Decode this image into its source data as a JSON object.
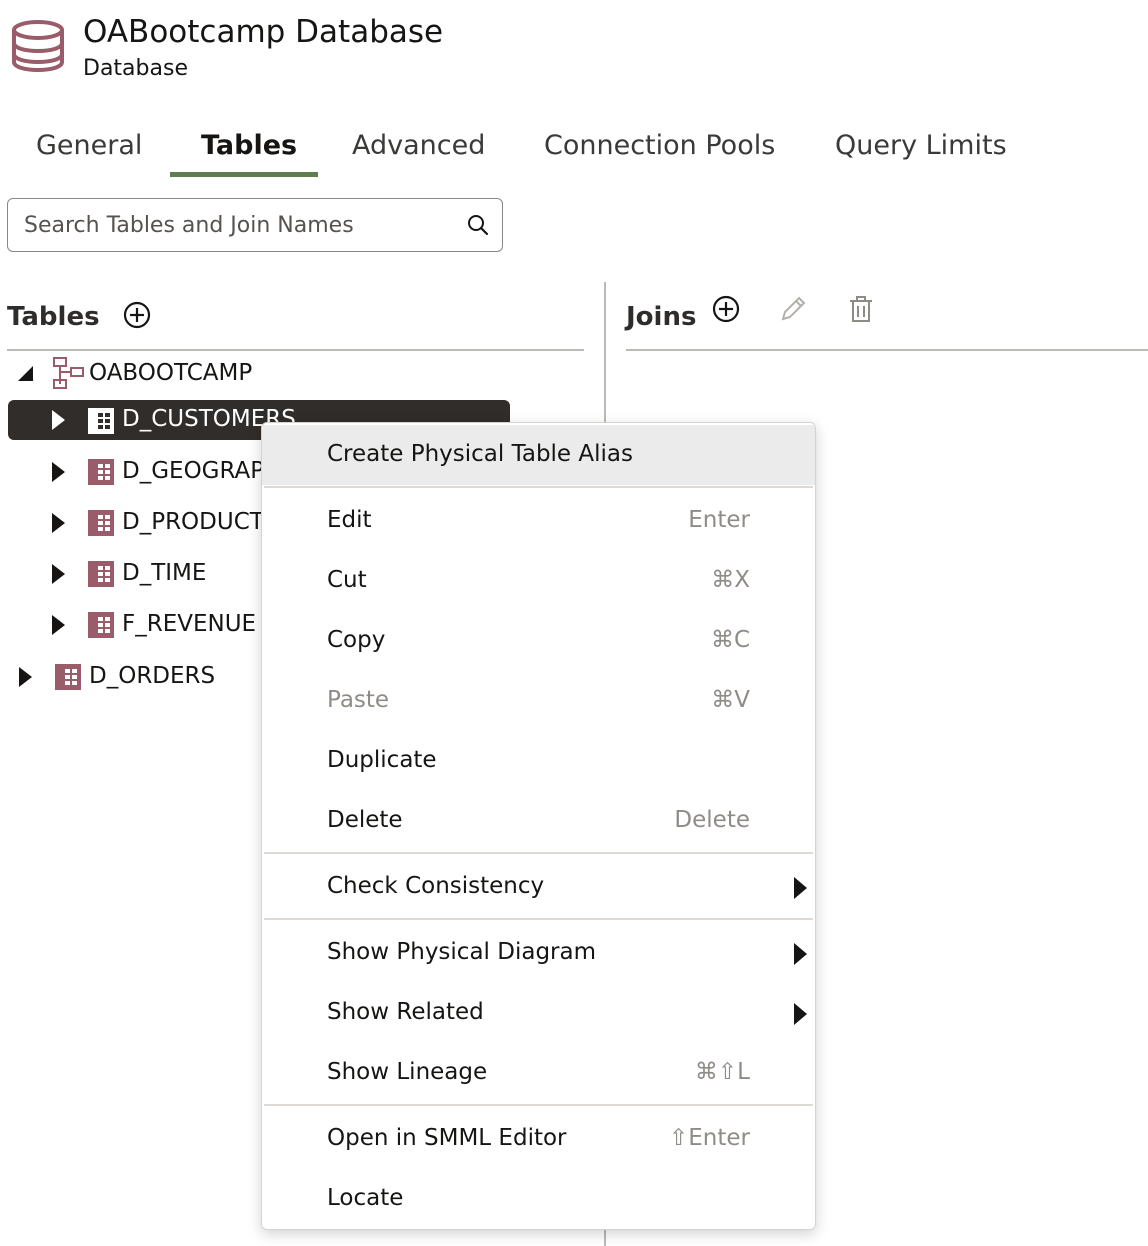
{
  "header": {
    "title": "OABootcamp Database",
    "subtitle": "Database",
    "icon": "database-icon",
    "icon_color": "#9a5b6a"
  },
  "tabs": [
    {
      "label": "General",
      "active": false
    },
    {
      "label": "Tables",
      "active": true
    },
    {
      "label": "Advanced",
      "active": false
    },
    {
      "label": "Connection Pools",
      "active": false
    },
    {
      "label": "Query Limits",
      "active": false
    }
  ],
  "accent_color": "#5f7d4f",
  "search": {
    "placeholder": "Search Tables and Join Names",
    "value": ""
  },
  "tables_panel": {
    "title": "Tables",
    "tree": [
      {
        "label": "OABOOTCAMP",
        "type": "schema",
        "expanded": true
      },
      {
        "label": "D_CUSTOMERS",
        "type": "table",
        "selected": true
      },
      {
        "label": "D_GEOGRAPHY",
        "type": "table"
      },
      {
        "label": "D_PRODUCTS",
        "type": "table"
      },
      {
        "label": "D_TIME",
        "type": "table"
      },
      {
        "label": "F_REVENUE",
        "type": "table"
      },
      {
        "label": "D_ORDERS",
        "type": "table"
      }
    ]
  },
  "joins_panel": {
    "title": "Joins"
  },
  "context_menu": {
    "items": [
      {
        "label": "Create Physical Table Alias",
        "shortcut": ""
      },
      {
        "label": "Edit",
        "shortcut": "Enter"
      },
      {
        "label": "Cut",
        "shortcut": "⌘X"
      },
      {
        "label": "Copy",
        "shortcut": "⌘C"
      },
      {
        "label": "Paste",
        "shortcut": "⌘V",
        "disabled": true
      },
      {
        "label": "Duplicate",
        "shortcut": ""
      },
      {
        "label": "Delete",
        "shortcut": "Delete"
      },
      {
        "label": "Check Consistency",
        "submenu": true
      },
      {
        "label": "Show Physical Diagram",
        "submenu": true
      },
      {
        "label": "Show Related",
        "submenu": true
      },
      {
        "label": "Show Lineage",
        "shortcut": "⌘⇧L"
      },
      {
        "label": "Open in SMML Editor",
        "shortcut": "⇧Enter"
      },
      {
        "label": "Locate",
        "shortcut": ""
      }
    ]
  }
}
